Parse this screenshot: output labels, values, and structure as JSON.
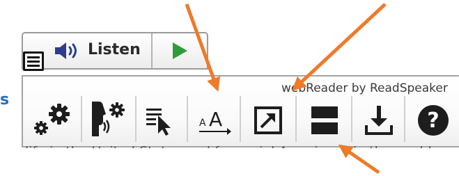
{
  "listen": {
    "label": "Listen"
  },
  "panel": {
    "brand": "webReader by ReadSpeaker"
  },
  "toolbar": {
    "buttons": [
      {
        "icon": "settings-gears-icon"
      },
      {
        "icon": "voice-settings-icon"
      },
      {
        "icon": "click-and-listen-icon"
      },
      {
        "icon": "text-size-icon"
      },
      {
        "icon": "popup-text-icon"
      },
      {
        "icon": "page-mask-icon"
      },
      {
        "icon": "download-icon"
      },
      {
        "icon": "help-icon"
      }
    ]
  },
  "page": {
    "edge_char": "s",
    "underlying_text": "life in the United States and for social Americans in the world"
  },
  "colors": {
    "annotation_arrow": "#ee7a2a",
    "play": "#2f9c3b",
    "icon_dark": "#1d1d1d"
  }
}
